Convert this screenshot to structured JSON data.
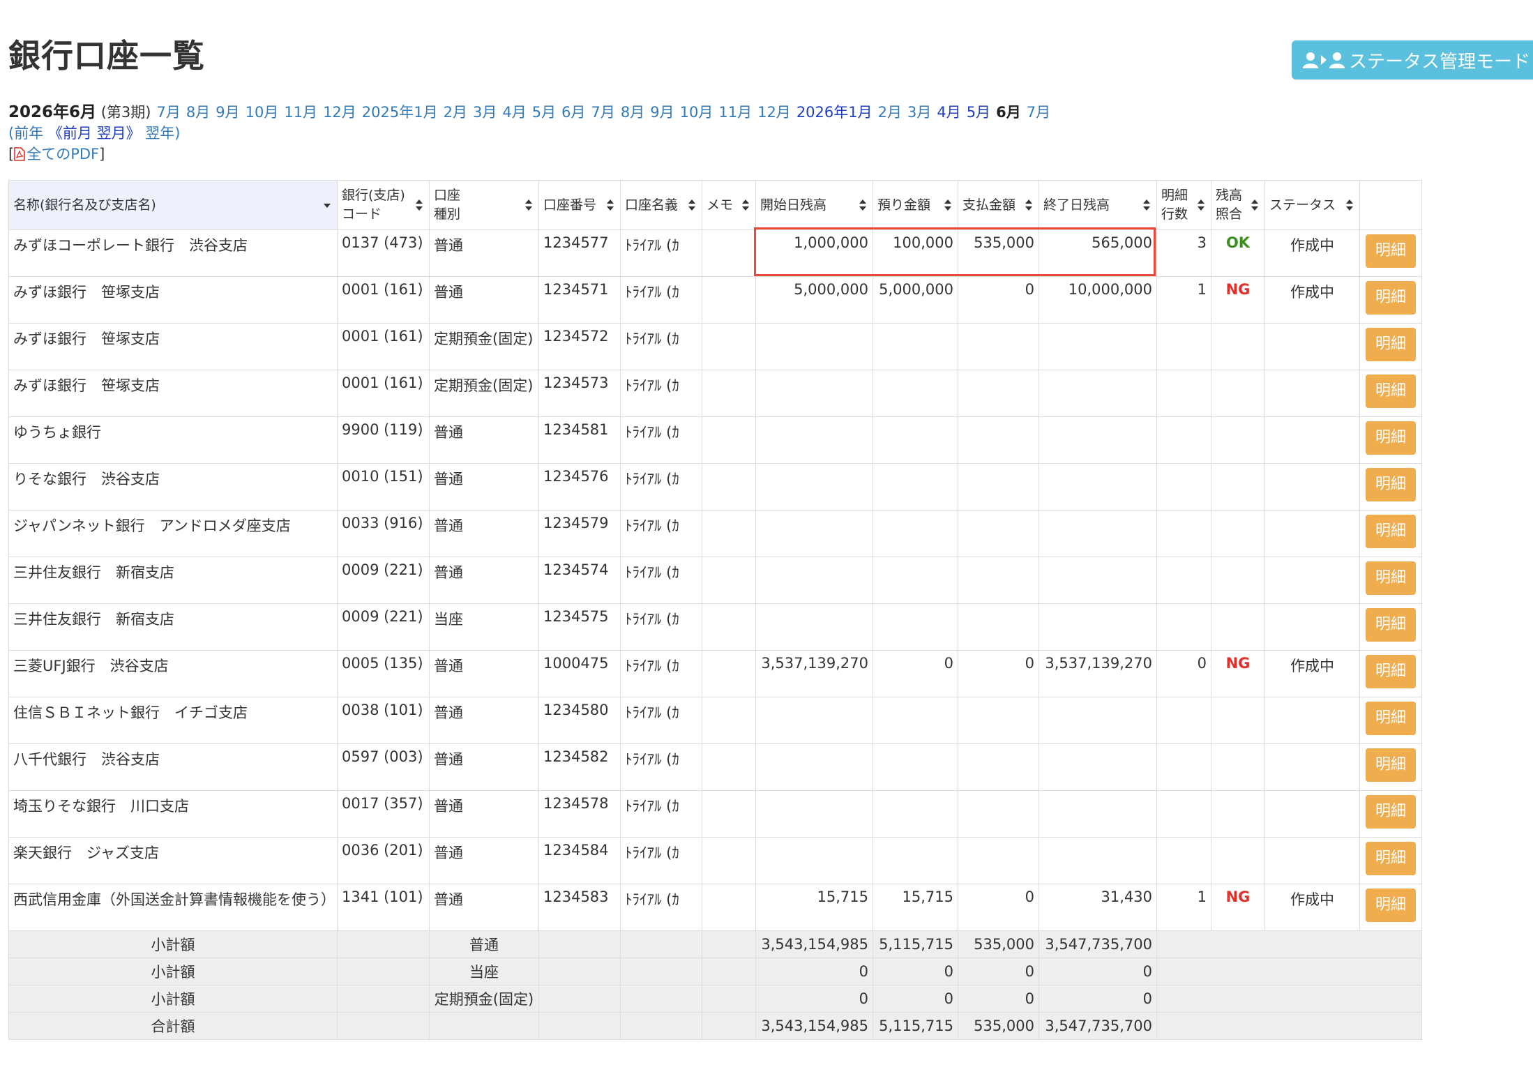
{
  "page": {
    "title": "銀行口座一覧"
  },
  "status_mode_button": {
    "label": "ステータス管理モード"
  },
  "period_nav": {
    "current_label": "2026年6月",
    "period": "(第3期)",
    "months": [
      {
        "label": "7月",
        "state": "normal"
      },
      {
        "label": "8月",
        "state": "normal"
      },
      {
        "label": "9月",
        "state": "normal"
      },
      {
        "label": "10月",
        "state": "normal"
      },
      {
        "label": "11月",
        "state": "normal"
      },
      {
        "label": "12月",
        "state": "normal"
      },
      {
        "label": "2025年1月",
        "state": "normal"
      },
      {
        "label": "2月",
        "state": "normal"
      },
      {
        "label": "3月",
        "state": "normal"
      },
      {
        "label": "4月",
        "state": "normal"
      },
      {
        "label": "5月",
        "state": "normal"
      },
      {
        "label": "6月",
        "state": "normal"
      },
      {
        "label": "7月",
        "state": "normal"
      },
      {
        "label": "8月",
        "state": "normal"
      },
      {
        "label": "9月",
        "state": "normal"
      },
      {
        "label": "10月",
        "state": "normal"
      },
      {
        "label": "11月",
        "state": "normal"
      },
      {
        "label": "12月",
        "state": "normal"
      },
      {
        "label": "2026年1月",
        "state": "strong"
      },
      {
        "label": "2月",
        "state": "normal"
      },
      {
        "label": "3月",
        "state": "normal"
      },
      {
        "label": "4月",
        "state": "strong"
      },
      {
        "label": "5月",
        "state": "strong"
      },
      {
        "label": "6月",
        "state": "active"
      },
      {
        "label": "7月",
        "state": "normal"
      }
    ],
    "prev_year": "前年",
    "prev_month": "《前月",
    "next_month": "翌月》",
    "next_year": "翌年",
    "pdf_link": "全てのPDF"
  },
  "table": {
    "headers": {
      "name": "名称(銀行名及び支店名)",
      "bank_code_1": "銀行(支店)",
      "bank_code_2": "コード",
      "type_1": "口座",
      "type_2": "種別",
      "number": "口座番号",
      "holder": "口座名義",
      "memo": "メモ",
      "start_balance": "開始日残高",
      "deposit": "預り金額",
      "payment": "支払金額",
      "end_balance": "終了日残高",
      "lines_1": "明細",
      "lines_2": "行数",
      "check_1": "残高",
      "check_2": "照合",
      "status": "ステータス"
    },
    "detail_button_label": "明細",
    "rows": [
      {
        "name": "みずほコーポレート銀行　渋谷支店",
        "code": "0137 (473)",
        "type": "普通",
        "number": "1234577",
        "holder": "ﾄﾗｲｱﾙ (ｶ",
        "memo": "",
        "start": "1,000,000",
        "deposit": "100,000",
        "payment": "535,000",
        "end": "565,000",
        "lines": "3",
        "check": "OK",
        "status": "作成中"
      },
      {
        "name": "みずほ銀行　笹塚支店",
        "code": "0001 (161)",
        "type": "普通",
        "number": "1234571",
        "holder": "ﾄﾗｲｱﾙ (ｶ",
        "memo": "",
        "start": "5,000,000",
        "deposit": "5,000,000",
        "payment": "0",
        "end": "10,000,000",
        "lines": "1",
        "check": "NG",
        "status": "作成中"
      },
      {
        "name": "みずほ銀行　笹塚支店",
        "code": "0001 (161)",
        "type": "定期預金(固定)",
        "number": "1234572",
        "holder": "ﾄﾗｲｱﾙ (ｶ",
        "memo": "",
        "start": "",
        "deposit": "",
        "payment": "",
        "end": "",
        "lines": "",
        "check": "",
        "status": ""
      },
      {
        "name": "みずほ銀行　笹塚支店",
        "code": "0001 (161)",
        "type": "定期預金(固定)",
        "number": "1234573",
        "holder": "ﾄﾗｲｱﾙ (ｶ",
        "memo": "",
        "start": "",
        "deposit": "",
        "payment": "",
        "end": "",
        "lines": "",
        "check": "",
        "status": ""
      },
      {
        "name": "ゆうちょ銀行",
        "code": "9900 (119)",
        "type": "普通",
        "number": "1234581",
        "holder": "ﾄﾗｲｱﾙ (ｶ",
        "memo": "",
        "start": "",
        "deposit": "",
        "payment": "",
        "end": "",
        "lines": "",
        "check": "",
        "status": ""
      },
      {
        "name": "りそな銀行　渋谷支店",
        "code": "0010 (151)",
        "type": "普通",
        "number": "1234576",
        "holder": "ﾄﾗｲｱﾙ (ｶ",
        "memo": "",
        "start": "",
        "deposit": "",
        "payment": "",
        "end": "",
        "lines": "",
        "check": "",
        "status": ""
      },
      {
        "name": "ジャパンネット銀行　アンドロメダ座支店",
        "code": "0033 (916)",
        "type": "普通",
        "number": "1234579",
        "holder": "ﾄﾗｲｱﾙ (ｶ",
        "memo": "",
        "start": "",
        "deposit": "",
        "payment": "",
        "end": "",
        "lines": "",
        "check": "",
        "status": ""
      },
      {
        "name": "三井住友銀行　新宿支店",
        "code": "0009 (221)",
        "type": "普通",
        "number": "1234574",
        "holder": "ﾄﾗｲｱﾙ (ｶ",
        "memo": "",
        "start": "",
        "deposit": "",
        "payment": "",
        "end": "",
        "lines": "",
        "check": "",
        "status": ""
      },
      {
        "name": "三井住友銀行　新宿支店",
        "code": "0009 (221)",
        "type": "当座",
        "number": "1234575",
        "holder": "ﾄﾗｲｱﾙ (ｶ",
        "memo": "",
        "start": "",
        "deposit": "",
        "payment": "",
        "end": "",
        "lines": "",
        "check": "",
        "status": ""
      },
      {
        "name": "三菱UFJ銀行　渋谷支店",
        "code": "0005 (135)",
        "type": "普通",
        "number": "1000475",
        "holder": "ﾄﾗｲｱﾙ (ｶ",
        "memo": "",
        "start": "3,537,139,270",
        "deposit": "0",
        "payment": "0",
        "end": "3,537,139,270",
        "lines": "0",
        "check": "NG",
        "status": "作成中"
      },
      {
        "name": "住信ＳＢＩネット銀行　イチゴ支店",
        "code": "0038 (101)",
        "type": "普通",
        "number": "1234580",
        "holder": "ﾄﾗｲｱﾙ (ｶ",
        "memo": "",
        "start": "",
        "deposit": "",
        "payment": "",
        "end": "",
        "lines": "",
        "check": "",
        "status": ""
      },
      {
        "name": "八千代銀行　渋谷支店",
        "code": "0597 (003)",
        "type": "普通",
        "number": "1234582",
        "holder": "ﾄﾗｲｱﾙ (ｶ",
        "memo": "",
        "start": "",
        "deposit": "",
        "payment": "",
        "end": "",
        "lines": "",
        "check": "",
        "status": ""
      },
      {
        "name": "埼玉りそな銀行　川口支店",
        "code": "0017 (357)",
        "type": "普通",
        "number": "1234578",
        "holder": "ﾄﾗｲｱﾙ (ｶ",
        "memo": "",
        "start": "",
        "deposit": "",
        "payment": "",
        "end": "",
        "lines": "",
        "check": "",
        "status": ""
      },
      {
        "name": "楽天銀行　ジャズ支店",
        "code": "0036 (201)",
        "type": "普通",
        "number": "1234584",
        "holder": "ﾄﾗｲｱﾙ (ｶ",
        "memo": "",
        "start": "",
        "deposit": "",
        "payment": "",
        "end": "",
        "lines": "",
        "check": "",
        "status": ""
      },
      {
        "name": "西武信用金庫（外国送金計算書情報機能を使う）",
        "code": "1341 (101)",
        "type": "普通",
        "number": "1234583",
        "holder": "ﾄﾗｲｱﾙ (ｶ",
        "memo": "",
        "start": "15,715",
        "deposit": "15,715",
        "payment": "0",
        "end": "31,430",
        "lines": "1",
        "check": "NG",
        "status": "作成中"
      }
    ],
    "summary_rows": [
      {
        "label": "小計額",
        "type": "普通",
        "start": "3,543,154,985",
        "deposit": "5,115,715",
        "payment": "535,000",
        "end": "3,547,735,700"
      },
      {
        "label": "小計額",
        "type": "当座",
        "start": "0",
        "deposit": "0",
        "payment": "0",
        "end": "0"
      },
      {
        "label": "小計額",
        "type": "定期預金(固定)",
        "start": "0",
        "deposit": "0",
        "payment": "0",
        "end": "0"
      },
      {
        "label": "合計額",
        "type": "",
        "start": "3,543,154,985",
        "deposit": "5,115,715",
        "payment": "535,000",
        "end": "3,547,735,700"
      }
    ]
  }
}
